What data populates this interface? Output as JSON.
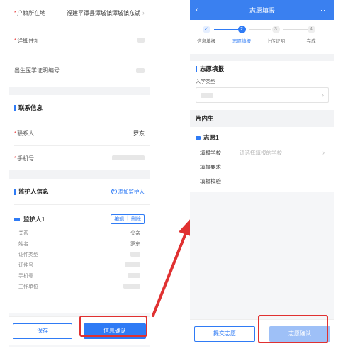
{
  "left": {
    "form": {
      "hukou_label": "户籍所在地",
      "hukou_value": "福建平潭县潭城镇潭城镇东湖",
      "address_label": "详细住址",
      "birth_cert_label": "出生医学证明编号"
    },
    "contact": {
      "section_title": "联系信息",
      "contact_person_label": "联系人",
      "contact_person_value": "罗东",
      "phone_label": "手机号"
    },
    "guardian": {
      "section_title": "监护人信息",
      "add_label": "添加监护人",
      "card_title": "监护人1",
      "edit_label": "编辑",
      "divider": "|",
      "delete_label": "删除",
      "fields": [
        {
          "k": "关系",
          "v": "父亲"
        },
        {
          "k": "姓名",
          "v": "罗东"
        },
        {
          "k": "证件类型",
          "v": ""
        },
        {
          "k": "证件号",
          "v": ""
        },
        {
          "k": "手机号",
          "v": ""
        },
        {
          "k": "工作单位",
          "v": ""
        }
      ]
    },
    "footer": {
      "save_label": "保存",
      "confirm_label": "信息确认"
    }
  },
  "right": {
    "topbar": {
      "back": "‹",
      "title": "志愿填报",
      "more": "···"
    },
    "steps": [
      {
        "num": "✓",
        "label": "信息填报",
        "state": "done"
      },
      {
        "num": "2",
        "label": "志愿填报",
        "state": "active"
      },
      {
        "num": "3",
        "label": "上传证明",
        "state": "todo"
      },
      {
        "num": "4",
        "label": "完成",
        "state": "todo"
      }
    ],
    "form": {
      "section_title": "志愿填报",
      "enroll_type_label": "入学类型",
      "district_title": "片内生",
      "wish_title": "志愿1",
      "school_label": "填报学校",
      "school_placeholder": "请选择填报的学校",
      "requirement_label": "填报要求",
      "check_label": "填报校验"
    },
    "footer": {
      "submit_label": "提交志愿",
      "confirm_label": "志愿确认"
    }
  },
  "colors": {
    "primary": "#2f7bf5",
    "topbar": "#3a80f0",
    "highlight": "#e03131",
    "required": "#e84040"
  }
}
